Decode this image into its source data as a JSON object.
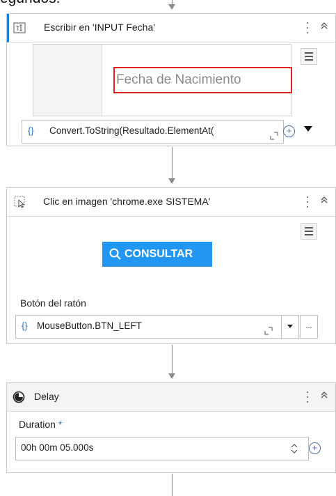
{
  "top_text": "egundos.",
  "activities": [
    {
      "title": "Escribir en 'INPUT  Fecha'",
      "preview_input_text": "Fecha de Nacimiento",
      "expression": "Convert.ToString(Resultado.ElementAt("
    },
    {
      "title": "Clic en imagen 'chrome.exe SISTEMA'",
      "preview_button_label": "CONSULTAR",
      "field_label": "Botón del ratón",
      "field_value": "MouseButton.BTN_LEFT",
      "ellipsis": "..."
    },
    {
      "title": "Delay",
      "field_label": "Duration",
      "required_mark": "*",
      "field_value": "00h 00m 05.000s"
    }
  ],
  "colors": {
    "accent": "#1e7fd6",
    "highlight_border": "#e02020",
    "consultar_bg": "#2196f3"
  },
  "icons": {
    "type_into": "type-into-icon",
    "click_image": "click-image-icon",
    "delay": "clock-icon",
    "menu": "hamburger-menu-icon",
    "expression": "curly-braces-icon",
    "collapse": "chevron-up-double-icon"
  }
}
